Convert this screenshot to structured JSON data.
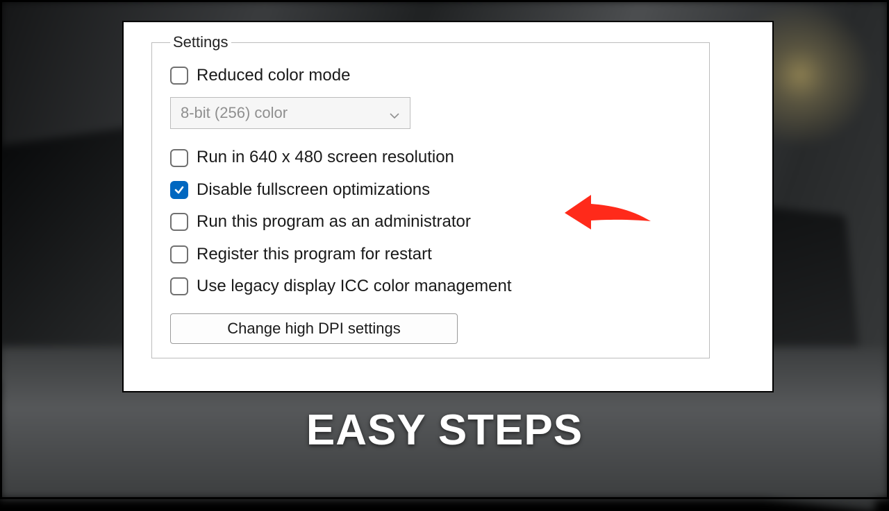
{
  "settings": {
    "legend": "Settings",
    "reduced_color_mode": {
      "label": "Reduced color mode",
      "checked": false
    },
    "color_mode_select": {
      "value": "8-bit (256) color",
      "enabled": false
    },
    "run_640x480": {
      "label": "Run in 640 x 480 screen resolution",
      "checked": false
    },
    "disable_fullscreen_opt": {
      "label": "Disable fullscreen optimizations",
      "checked": true
    },
    "run_as_admin": {
      "label": "Run this program as an administrator",
      "checked": false
    },
    "register_for_restart": {
      "label": "Register this program for restart",
      "checked": false
    },
    "legacy_icc": {
      "label": "Use legacy display ICC color management",
      "checked": false
    },
    "dpi_button": "Change high DPI settings"
  },
  "annotation": {
    "arrow_target": "disable_fullscreen_opt",
    "arrow_color": "#ff2a1a"
  },
  "caption": "EASY STEPS"
}
